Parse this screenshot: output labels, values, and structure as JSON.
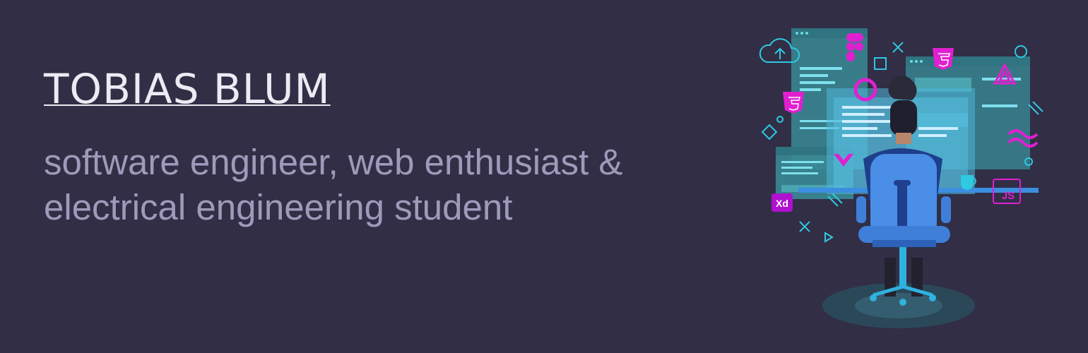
{
  "hero": {
    "name": "TOBIAS BLUM",
    "tagline_line1": "software engineer, web enthusiast &",
    "tagline_line2": "electrical engineering student"
  },
  "illustration": {
    "badges": {
      "xd": "Xd",
      "js": "JS"
    },
    "icons": [
      "cloud-upload-icon",
      "figma-icon",
      "html5-icon",
      "github-icon",
      "chevron-down-icon",
      "angular-icon",
      "tailwind-icon",
      "coffee-cup-icon",
      "xd-icon",
      "js-icon"
    ]
  },
  "colors": {
    "background": "#312e46",
    "name_text": "#ecebf3",
    "tagline_text": "#9e9bba",
    "accent_magenta": "#e020d0",
    "accent_cyan": "#2fc9e0",
    "screen_teal": "#2e7f8e",
    "chair_blue": "#4a8ee8"
  }
}
